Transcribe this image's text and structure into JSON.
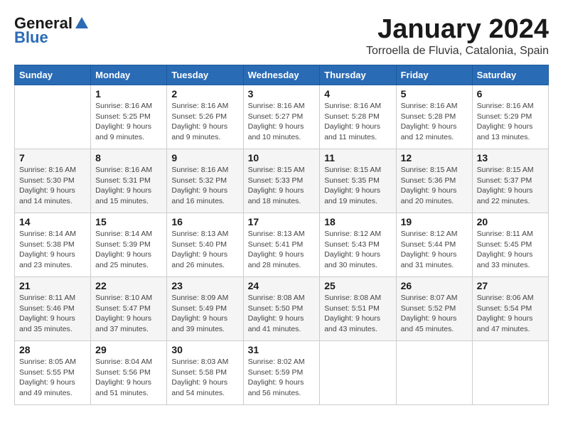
{
  "logo": {
    "general": "General",
    "blue": "Blue"
  },
  "header": {
    "month": "January 2024",
    "location": "Torroella de Fluvia, Catalonia, Spain"
  },
  "weekdays": [
    "Sunday",
    "Monday",
    "Tuesday",
    "Wednesday",
    "Thursday",
    "Friday",
    "Saturday"
  ],
  "weeks": [
    [
      {
        "day": "",
        "info": ""
      },
      {
        "day": "1",
        "info": "Sunrise: 8:16 AM\nSunset: 5:25 PM\nDaylight: 9 hours\nand 9 minutes."
      },
      {
        "day": "2",
        "info": "Sunrise: 8:16 AM\nSunset: 5:26 PM\nDaylight: 9 hours\nand 9 minutes."
      },
      {
        "day": "3",
        "info": "Sunrise: 8:16 AM\nSunset: 5:27 PM\nDaylight: 9 hours\nand 10 minutes."
      },
      {
        "day": "4",
        "info": "Sunrise: 8:16 AM\nSunset: 5:28 PM\nDaylight: 9 hours\nand 11 minutes."
      },
      {
        "day": "5",
        "info": "Sunrise: 8:16 AM\nSunset: 5:28 PM\nDaylight: 9 hours\nand 12 minutes."
      },
      {
        "day": "6",
        "info": "Sunrise: 8:16 AM\nSunset: 5:29 PM\nDaylight: 9 hours\nand 13 minutes."
      }
    ],
    [
      {
        "day": "7",
        "info": "Sunrise: 8:16 AM\nSunset: 5:30 PM\nDaylight: 9 hours\nand 14 minutes."
      },
      {
        "day": "8",
        "info": "Sunrise: 8:16 AM\nSunset: 5:31 PM\nDaylight: 9 hours\nand 15 minutes."
      },
      {
        "day": "9",
        "info": "Sunrise: 8:16 AM\nSunset: 5:32 PM\nDaylight: 9 hours\nand 16 minutes."
      },
      {
        "day": "10",
        "info": "Sunrise: 8:15 AM\nSunset: 5:33 PM\nDaylight: 9 hours\nand 18 minutes."
      },
      {
        "day": "11",
        "info": "Sunrise: 8:15 AM\nSunset: 5:35 PM\nDaylight: 9 hours\nand 19 minutes."
      },
      {
        "day": "12",
        "info": "Sunrise: 8:15 AM\nSunset: 5:36 PM\nDaylight: 9 hours\nand 20 minutes."
      },
      {
        "day": "13",
        "info": "Sunrise: 8:15 AM\nSunset: 5:37 PM\nDaylight: 9 hours\nand 22 minutes."
      }
    ],
    [
      {
        "day": "14",
        "info": "Sunrise: 8:14 AM\nSunset: 5:38 PM\nDaylight: 9 hours\nand 23 minutes."
      },
      {
        "day": "15",
        "info": "Sunrise: 8:14 AM\nSunset: 5:39 PM\nDaylight: 9 hours\nand 25 minutes."
      },
      {
        "day": "16",
        "info": "Sunrise: 8:13 AM\nSunset: 5:40 PM\nDaylight: 9 hours\nand 26 minutes."
      },
      {
        "day": "17",
        "info": "Sunrise: 8:13 AM\nSunset: 5:41 PM\nDaylight: 9 hours\nand 28 minutes."
      },
      {
        "day": "18",
        "info": "Sunrise: 8:12 AM\nSunset: 5:43 PM\nDaylight: 9 hours\nand 30 minutes."
      },
      {
        "day": "19",
        "info": "Sunrise: 8:12 AM\nSunset: 5:44 PM\nDaylight: 9 hours\nand 31 minutes."
      },
      {
        "day": "20",
        "info": "Sunrise: 8:11 AM\nSunset: 5:45 PM\nDaylight: 9 hours\nand 33 minutes."
      }
    ],
    [
      {
        "day": "21",
        "info": "Sunrise: 8:11 AM\nSunset: 5:46 PM\nDaylight: 9 hours\nand 35 minutes."
      },
      {
        "day": "22",
        "info": "Sunrise: 8:10 AM\nSunset: 5:47 PM\nDaylight: 9 hours\nand 37 minutes."
      },
      {
        "day": "23",
        "info": "Sunrise: 8:09 AM\nSunset: 5:49 PM\nDaylight: 9 hours\nand 39 minutes."
      },
      {
        "day": "24",
        "info": "Sunrise: 8:08 AM\nSunset: 5:50 PM\nDaylight: 9 hours\nand 41 minutes."
      },
      {
        "day": "25",
        "info": "Sunrise: 8:08 AM\nSunset: 5:51 PM\nDaylight: 9 hours\nand 43 minutes."
      },
      {
        "day": "26",
        "info": "Sunrise: 8:07 AM\nSunset: 5:52 PM\nDaylight: 9 hours\nand 45 minutes."
      },
      {
        "day": "27",
        "info": "Sunrise: 8:06 AM\nSunset: 5:54 PM\nDaylight: 9 hours\nand 47 minutes."
      }
    ],
    [
      {
        "day": "28",
        "info": "Sunrise: 8:05 AM\nSunset: 5:55 PM\nDaylight: 9 hours\nand 49 minutes."
      },
      {
        "day": "29",
        "info": "Sunrise: 8:04 AM\nSunset: 5:56 PM\nDaylight: 9 hours\nand 51 minutes."
      },
      {
        "day": "30",
        "info": "Sunrise: 8:03 AM\nSunset: 5:58 PM\nDaylight: 9 hours\nand 54 minutes."
      },
      {
        "day": "31",
        "info": "Sunrise: 8:02 AM\nSunset: 5:59 PM\nDaylight: 9 hours\nand 56 minutes."
      },
      {
        "day": "",
        "info": ""
      },
      {
        "day": "",
        "info": ""
      },
      {
        "day": "",
        "info": ""
      }
    ]
  ]
}
